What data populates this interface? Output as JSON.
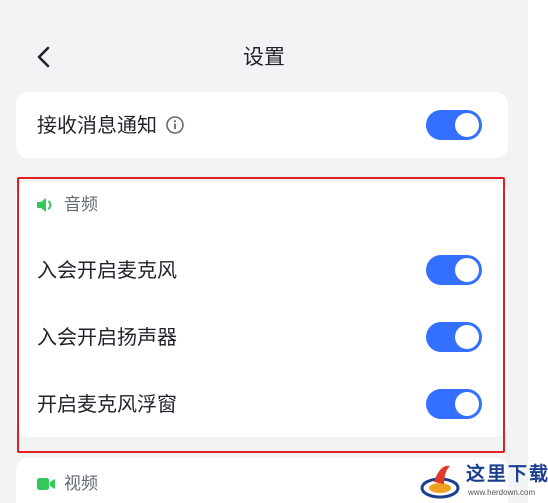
{
  "header": {
    "title": "设置"
  },
  "notifications": {
    "label": "接收消息通知",
    "enabled": true
  },
  "audio": {
    "section_label": "音频",
    "items": [
      {
        "label": "入会开启麦克风",
        "enabled": true
      },
      {
        "label": "入会开启扬声器",
        "enabled": true
      },
      {
        "label": "开启麦克风浮窗",
        "enabled": true
      }
    ]
  },
  "video": {
    "section_label": "视频"
  },
  "watermark": {
    "text": "这里下载",
    "url": "www.herdown.com"
  },
  "colors": {
    "accent": "#3370ff",
    "audio_icon": "#34c759",
    "video_icon": "#34c759",
    "highlight": "#e02020"
  },
  "icons": {
    "back": "chevron-left-icon",
    "info": "info-circle-icon",
    "audio": "speaker-icon",
    "video": "camera-icon"
  }
}
